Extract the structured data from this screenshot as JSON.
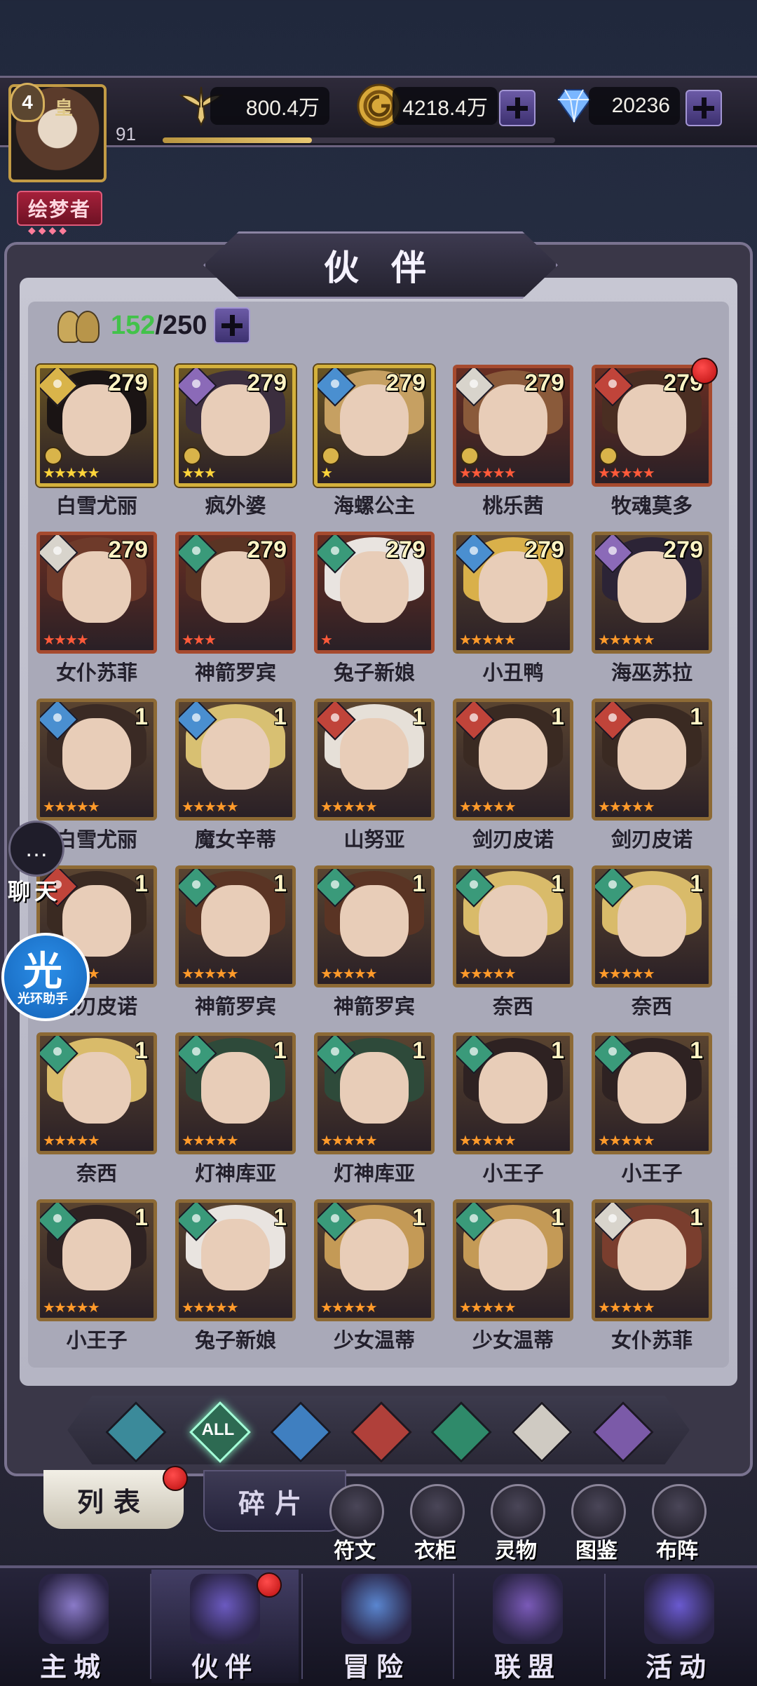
{
  "player": {
    "level": "4",
    "vip_label": "皇",
    "sub_level": "91",
    "title": "绘梦者",
    "title_dots": "◆◆◆◆",
    "exp_progress": 0.38
  },
  "resources": [
    {
      "name": "power",
      "icon": "winged-sword-icon",
      "value": "800.4万",
      "has_plus": false
    },
    {
      "name": "gold",
      "icon": "gold-coin-icon",
      "value": "4218.4万",
      "has_plus": true
    },
    {
      "name": "diamond",
      "icon": "diamond-icon",
      "value": "20236",
      "has_plus": true
    }
  ],
  "page_title": "伙 伴",
  "roster": {
    "owned": "152",
    "separator_max": "/250"
  },
  "heroes": [
    {
      "name": "白雪尤丽",
      "level": "279",
      "element": "light",
      "stars": 5,
      "star_color": "gold",
      "frame": "gold",
      "rank_badge": true,
      "hair": "#1a1414",
      "alert": false
    },
    {
      "name": "疯外婆",
      "level": "279",
      "element": "void",
      "stars": 3,
      "star_color": "gold",
      "frame": "gold",
      "rank_badge": true,
      "hair": "#3b2e3e",
      "alert": false
    },
    {
      "name": "海螺公主",
      "level": "279",
      "element": "water",
      "stars": 1,
      "star_color": "gold",
      "frame": "gold",
      "rank_badge": true,
      "hair": "#c6a062",
      "alert": false
    },
    {
      "name": "桃乐茜",
      "level": "279",
      "element": "light-star",
      "stars": 5,
      "star_color": "red",
      "frame": "red",
      "rank_badge": true,
      "hair": "#8a5a3a",
      "alert": false
    },
    {
      "name": "牧魂莫多",
      "level": "279",
      "element": "fire",
      "stars": 5,
      "star_color": "red",
      "frame": "red",
      "rank_badge": true,
      "hair": "#4a2e22",
      "alert": true
    },
    {
      "name": "女仆苏菲",
      "level": "279",
      "element": "light-star",
      "stars": 4,
      "star_color": "red",
      "frame": "red",
      "rank_badge": false,
      "hair": "#6e3a2a",
      "alert": false
    },
    {
      "name": "神箭罗宾",
      "level": "279",
      "element": "wind",
      "stars": 3,
      "star_color": "red",
      "frame": "red",
      "rank_badge": false,
      "hair": "#5a3424",
      "alert": false
    },
    {
      "name": "兔子新娘",
      "level": "279",
      "element": "wind",
      "stars": 1,
      "star_color": "red",
      "frame": "red",
      "rank_badge": false,
      "hair": "#e9e4e0",
      "alert": false
    },
    {
      "name": "小丑鸭",
      "level": "279",
      "element": "water",
      "stars": 5,
      "star_color": "orange",
      "frame": "bronze",
      "rank_badge": false,
      "hair": "#d9b04a",
      "alert": false
    },
    {
      "name": "海巫苏拉",
      "level": "279",
      "element": "void",
      "stars": 5,
      "star_color": "orange",
      "frame": "bronze",
      "rank_badge": false,
      "hair": "#2c2436",
      "alert": false
    },
    {
      "name": "白雪尤丽",
      "level": "1",
      "element": "water",
      "stars": 5,
      "star_color": "orange",
      "frame": "bronze",
      "rank_badge": false,
      "hair": "#3a2a24",
      "alert": false
    },
    {
      "name": "魔女辛蒂",
      "level": "1",
      "element": "water",
      "stars": 5,
      "star_color": "orange",
      "frame": "bronze",
      "rank_badge": false,
      "hair": "#d8c072",
      "alert": false
    },
    {
      "name": "山努亚",
      "level": "1",
      "element": "fire",
      "stars": 5,
      "star_color": "orange",
      "frame": "bronze",
      "rank_badge": false,
      "hair": "#e6e0d8",
      "alert": false
    },
    {
      "name": "剑刃皮诺",
      "level": "1",
      "element": "fire",
      "stars": 5,
      "star_color": "orange",
      "frame": "bronze",
      "rank_badge": false,
      "hair": "#3a2a22",
      "alert": false
    },
    {
      "name": "剑刃皮诺",
      "level": "1",
      "element": "fire",
      "stars": 5,
      "star_color": "orange",
      "frame": "bronze",
      "rank_badge": false,
      "hair": "#3a2a22",
      "alert": false
    },
    {
      "name": "剑刃皮诺",
      "level": "1",
      "element": "fire",
      "stars": 5,
      "star_color": "orange",
      "frame": "bronze",
      "rank_badge": false,
      "hair": "#3a2a22",
      "alert": false
    },
    {
      "name": "神箭罗宾",
      "level": "1",
      "element": "wind",
      "stars": 5,
      "star_color": "orange",
      "frame": "bronze",
      "rank_badge": false,
      "hair": "#5a3424",
      "alert": false
    },
    {
      "name": "神箭罗宾",
      "level": "1",
      "element": "wind",
      "stars": 5,
      "star_color": "orange",
      "frame": "bronze",
      "rank_badge": false,
      "hair": "#5a3424",
      "alert": false
    },
    {
      "name": "奈西",
      "level": "1",
      "element": "wind",
      "stars": 5,
      "star_color": "orange",
      "frame": "bronze",
      "rank_badge": false,
      "hair": "#d9bb6a",
      "alert": false
    },
    {
      "name": "奈西",
      "level": "1",
      "element": "wind",
      "stars": 5,
      "star_color": "orange",
      "frame": "bronze",
      "rank_badge": false,
      "hair": "#d9bb6a",
      "alert": false
    },
    {
      "name": "奈西",
      "level": "1",
      "element": "wind",
      "stars": 5,
      "star_color": "orange",
      "frame": "bronze",
      "rank_badge": false,
      "hair": "#d9bb6a",
      "alert": false
    },
    {
      "name": "灯神库亚",
      "level": "1",
      "element": "wind",
      "stars": 5,
      "star_color": "orange",
      "frame": "bronze",
      "rank_badge": false,
      "hair": "#2e4a3a",
      "alert": false
    },
    {
      "name": "灯神库亚",
      "level": "1",
      "element": "wind",
      "stars": 5,
      "star_color": "orange",
      "frame": "bronze",
      "rank_badge": false,
      "hair": "#2e4a3a",
      "alert": false
    },
    {
      "name": "小王子",
      "level": "1",
      "element": "wind",
      "stars": 5,
      "star_color": "orange",
      "frame": "bronze",
      "rank_badge": false,
      "hair": "#2e2222",
      "alert": false
    },
    {
      "name": "小王子",
      "level": "1",
      "element": "wind",
      "stars": 5,
      "star_color": "orange",
      "frame": "bronze",
      "rank_badge": false,
      "hair": "#2e2222",
      "alert": false
    },
    {
      "name": "小王子",
      "level": "1",
      "element": "wind",
      "stars": 5,
      "star_color": "orange",
      "frame": "bronze",
      "rank_badge": false,
      "hair": "#2e2222",
      "alert": false
    },
    {
      "name": "兔子新娘",
      "level": "1",
      "element": "wind",
      "stars": 5,
      "star_color": "orange",
      "frame": "bronze",
      "rank_badge": false,
      "hair": "#e9e4e0",
      "alert": false
    },
    {
      "name": "少女温蒂",
      "level": "1",
      "element": "wind",
      "stars": 5,
      "star_color": "orange",
      "frame": "bronze",
      "rank_badge": false,
      "hair": "#c49a56",
      "alert": false
    },
    {
      "name": "少女温蒂",
      "level": "1",
      "element": "wind",
      "stars": 5,
      "star_color": "orange",
      "frame": "bronze",
      "rank_badge": false,
      "hair": "#c49a56",
      "alert": false
    },
    {
      "name": "女仆苏菲",
      "level": "1",
      "element": "light-star",
      "stars": 5,
      "star_color": "orange",
      "frame": "bronze",
      "rank_badge": false,
      "hair": "#7a3e2e",
      "alert": false
    }
  ],
  "element_colors": {
    "light": "#d9b44a",
    "void": "#8b6ab8",
    "water": "#4a8fd0",
    "fire": "#c0443a",
    "wind": "#3a9a7a",
    "light-star": "#d8d4cc"
  },
  "filters": [
    {
      "id": "dark",
      "icon": "dark-element-icon",
      "label": "",
      "color": "#3b8a9a"
    },
    {
      "id": "all",
      "icon": "all-elements-icon",
      "label": "ALL",
      "color": "#2d6a52",
      "selected": true
    },
    {
      "id": "water",
      "icon": "water-element-icon",
      "label": "",
      "color": "#3f7fc0"
    },
    {
      "id": "fire",
      "icon": "fire-element-icon",
      "label": "",
      "color": "#b0403a"
    },
    {
      "id": "wind",
      "icon": "wind-element-icon",
      "label": "",
      "color": "#2f8a6a"
    },
    {
      "id": "light",
      "icon": "light-element-icon",
      "label": "",
      "color": "#cfcac2"
    },
    {
      "id": "void",
      "icon": "void-element-icon",
      "label": "",
      "color": "#7b5aa8"
    }
  ],
  "subtabs": {
    "list": "列表",
    "fragments": "碎片"
  },
  "quick_buttons": [
    {
      "label": "符文",
      "icon": "rune-icon"
    },
    {
      "label": "衣柜",
      "icon": "wardrobe-icon"
    },
    {
      "label": "灵物",
      "icon": "spirit-item-icon"
    },
    {
      "label": "图鉴",
      "icon": "codex-icon"
    },
    {
      "label": "布阵",
      "icon": "formation-icon"
    }
  ],
  "nav": [
    {
      "label": "主城",
      "icon": "castle-icon",
      "active": false,
      "alert": false
    },
    {
      "label": "伙伴",
      "icon": "wizard-hat-icon",
      "active": true,
      "alert": true
    },
    {
      "label": "冒险",
      "icon": "compass-icon",
      "active": false,
      "alert": false
    },
    {
      "label": "联盟",
      "icon": "shield-icon",
      "active": false,
      "alert": false
    },
    {
      "label": "活动",
      "icon": "cards-icon",
      "active": false,
      "alert": false
    }
  ],
  "chat": {
    "label": "聊天",
    "icon": "chat-bubble-icon"
  },
  "assistant": {
    "glyph": "光",
    "label": "光环助手"
  },
  "star_colors": {
    "gold": "#ffd43a",
    "red": "#ff5a3a",
    "orange": "#ff9a2a"
  }
}
